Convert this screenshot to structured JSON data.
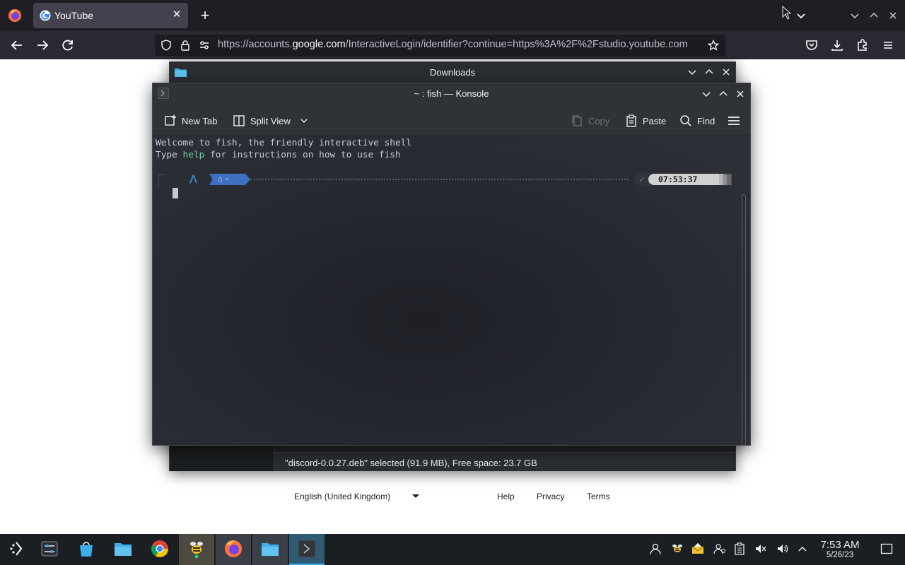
{
  "browser": {
    "tab_title": "YouTube",
    "url_prefix": "https://accounts.",
    "url_domain": "google.com",
    "url_rest": "/InteractiveLogin/identifier?continue=https%3A%2F%2Fstudio.youtube.com"
  },
  "google_page": {
    "language": "English (United Kingdom)",
    "help": "Help",
    "privacy": "Privacy",
    "terms": "Terms"
  },
  "dolphin": {
    "title": "Downloads",
    "status": "\"discord-0.0.27.deb\" selected (91.9 MB), Free space: 23.7 GB"
  },
  "konsole": {
    "title": "~ : fish — Konsole",
    "toolbar": {
      "new_tab": "New Tab",
      "split_view": "Split View",
      "copy": "Copy",
      "paste": "Paste",
      "find": "Find"
    },
    "terminal": {
      "welcome": "Welcome to fish, the friendly interactive shell",
      "line2_before": "Type ",
      "line2_keyword": "help",
      "line2_after": " for instructions on how to use fish",
      "prompt_dir": "~",
      "prompt_time": "07:53:37"
    }
  },
  "taskbar": {
    "time": "7:53 AM",
    "date": "5/26/23"
  }
}
